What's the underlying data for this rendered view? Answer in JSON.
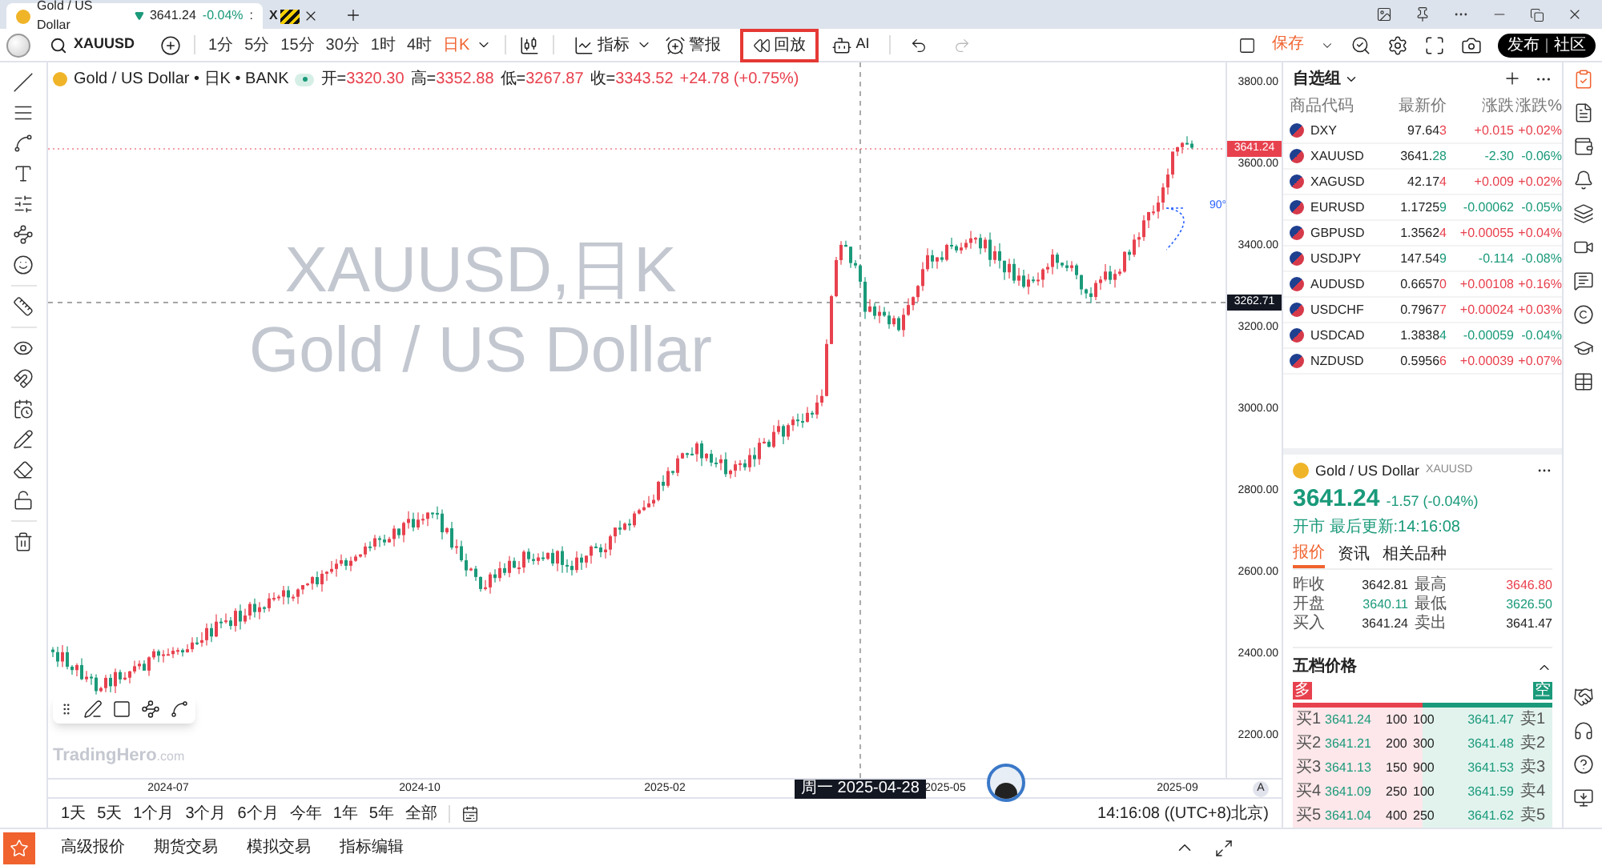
{
  "browser_tab": {
    "title": "Gold / US Dollar",
    "price": "3641.24",
    "change": "-0.04%",
    "separator": ":",
    "second_tab_label": "X"
  },
  "toolbar": {
    "symbol": "XAUUSD",
    "intervals": [
      {
        "label": "1分",
        "selected": false
      },
      {
        "label": "5分",
        "selected": false
      },
      {
        "label": "15分",
        "selected": false
      },
      {
        "label": "30分",
        "selected": false
      },
      {
        "label": "1时",
        "selected": false
      },
      {
        "label": "4时",
        "selected": false
      },
      {
        "label": "日K",
        "selected": true
      }
    ],
    "indicators": "指标",
    "alert": "警报",
    "replay": {
      "label": "回放",
      "highlighted": true
    },
    "ai": "AI",
    "save": "保存",
    "publish": "发布",
    "community": "社区"
  },
  "chart": {
    "legend": {
      "title": "Gold / US Dollar • 日K • BANK",
      "fields": [
        {
          "label": "开=",
          "value": "3320.30"
        },
        {
          "label": "高=",
          "value": "3352.88"
        },
        {
          "label": "低=",
          "value": "3267.87"
        },
        {
          "label": "收=",
          "value": "3343.52"
        }
      ],
      "change": "+24.78 (+0.75%)"
    },
    "watermark_lines": [
      "XAUUSD,日K",
      "Gold / US Dollar"
    ],
    "brand": "TradingHero",
    "brand_suffix": ".com",
    "price_ticks": [
      "3800.00",
      "3600.00",
      "3400.00",
      "3200.00",
      "3000.00",
      "2800.00",
      "2600.00",
      "2400.00",
      "2200.00"
    ],
    "last_price": "3641.24",
    "crosshair_price": "3262.71",
    "angle_label": "90°",
    "time_ticks": [
      "2024-07",
      "2024-10",
      "2025-02",
      "2025-05",
      "2025-09"
    ],
    "crosshair_date": "周一 2025-04-28",
    "scale_mode": "A"
  },
  "ranges": [
    "1天",
    "5天",
    "1个月",
    "3个月",
    "6个月",
    "今年",
    "1年",
    "5年",
    "全部"
  ],
  "clock": "14:16:08 ((UTC+8)北京)",
  "bottom_tabs": [
    "高级报价",
    "期货交易",
    "模拟交易",
    "指标编辑"
  ],
  "watchlist": {
    "title": "自选组",
    "columns": [
      "商品代码",
      "最新价",
      "涨跌",
      "涨跌%"
    ],
    "rows": [
      {
        "symbol": "DXY",
        "price": "97.64",
        "tail": "3",
        "change": "+0.015",
        "pct": "+0.02%",
        "kind": "up"
      },
      {
        "symbol": "XAUUSD",
        "price": "3641.",
        "tail": "28",
        "change": "-2.30",
        "pct": "-0.06%",
        "kind": "down"
      },
      {
        "symbol": "XAGUSD",
        "price": "42.17",
        "tail": "4",
        "change": "+0.009",
        "pct": "+0.02%",
        "kind": "up"
      },
      {
        "symbol": "EURUSD",
        "price": "1.1725",
        "tail": "9",
        "change": "-0.00062",
        "pct": "-0.05%",
        "kind": "down"
      },
      {
        "symbol": "GBPUSD",
        "price": "1.3562",
        "tail": "4",
        "change": "+0.00055",
        "pct": "+0.04%",
        "kind": "up"
      },
      {
        "symbol": "USDJPY",
        "price": "147.54",
        "tail": "9",
        "change": "-0.114",
        "pct": "-0.08%",
        "kind": "down"
      },
      {
        "symbol": "AUDUSD",
        "price": "0.6657",
        "tail": "0",
        "change": "+0.00108",
        "pct": "+0.16%",
        "kind": "up"
      },
      {
        "symbol": "USDCHF",
        "price": "0.7967",
        "tail": "7",
        "change": "+0.00024",
        "pct": "+0.03%",
        "kind": "up"
      },
      {
        "symbol": "USDCAD",
        "price": "1.3838",
        "tail": "4",
        "change": "-0.00059",
        "pct": "-0.04%",
        "kind": "down"
      },
      {
        "symbol": "NZDUSD",
        "price": "0.5956",
        "tail": "6",
        "change": "+0.00039",
        "pct": "+0.07%",
        "kind": "up"
      }
    ]
  },
  "quote": {
    "name": "Gold / US Dollar",
    "symbol": "XAUUSD",
    "price": "3641.24",
    "change": "-1.57 (-0.04%)",
    "status": "开市 最后更新:14:16:08",
    "tabs": [
      {
        "label": "报价",
        "selected": true
      },
      {
        "label": "资讯",
        "selected": false
      },
      {
        "label": "相关品种",
        "selected": false
      }
    ],
    "stats": [
      {
        "label": "昨收",
        "value": "3642.81",
        "kind": "flat"
      },
      {
        "label": "最高",
        "value": "3646.80",
        "kind": "up"
      },
      {
        "label": "开盘",
        "value": "3640.11",
        "kind": "down"
      },
      {
        "label": "最低",
        "value": "3626.50",
        "kind": "down"
      },
      {
        "label": "买入",
        "value": "3641.24",
        "kind": "flat"
      },
      {
        "label": "卖出",
        "value": "3641.47",
        "kind": "flat"
      }
    ],
    "book_title": "五档价格",
    "long_label": "多",
    "short_label": "空",
    "long_short_bar": {
      "level": 0.5
    },
    "book": [
      {
        "bid_label": "买1",
        "bid": "3641.24",
        "bid_vol": "100",
        "ask_vol": "100",
        "ask": "3641.47",
        "ask_label": "卖1"
      },
      {
        "bid_label": "买2",
        "bid": "3641.21",
        "bid_vol": "200",
        "ask_vol": "300",
        "ask": "3641.48",
        "ask_label": "卖2"
      },
      {
        "bid_label": "买3",
        "bid": "3641.13",
        "bid_vol": "150",
        "ask_vol": "900",
        "ask": "3641.53",
        "ask_label": "卖3"
      },
      {
        "bid_label": "买4",
        "bid": "3641.09",
        "bid_vol": "250",
        "ask_vol": "100",
        "ask": "3641.59",
        "ask_label": "卖4"
      },
      {
        "bid_label": "买5",
        "bid": "3641.04",
        "bid_vol": "400",
        "ask_vol": "250",
        "ask": "3641.62",
        "ask_label": "卖5"
      }
    ]
  }
}
